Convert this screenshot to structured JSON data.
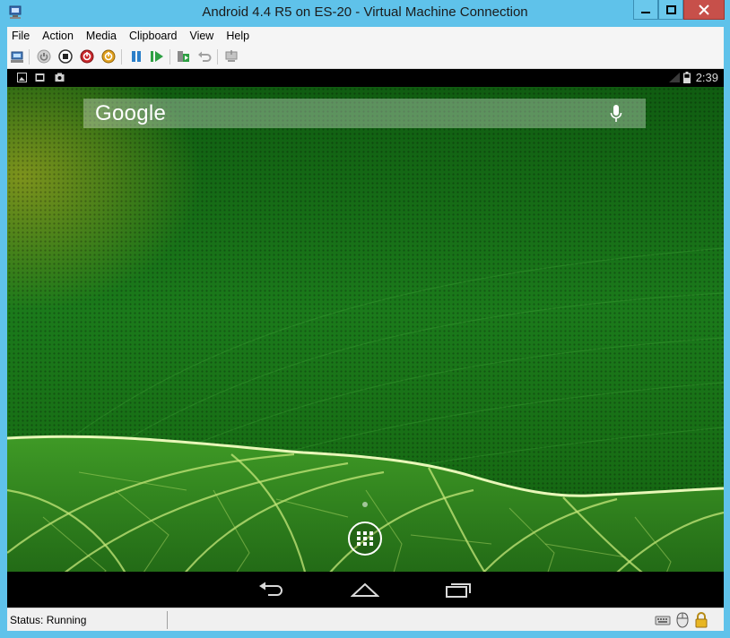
{
  "window": {
    "title": "Android 4.4 R5 on ES-20 - Virtual Machine Connection"
  },
  "menu": {
    "items": [
      "File",
      "Action",
      "Media",
      "Clipboard",
      "View",
      "Help"
    ]
  },
  "toolbar": {
    "buttons": [
      "ctrl-alt-del-icon",
      "start-icon",
      "turn-off-icon",
      "shut-down-icon",
      "save-icon",
      "pause-icon",
      "resume-icon",
      "checkpoint-icon",
      "revert-icon",
      "enhanced-session-icon"
    ]
  },
  "android": {
    "clock": "2:39",
    "search_logo": "Google",
    "wallpaper_colors": {
      "top": "#125e0f",
      "mid": "#1a7a1a",
      "leaf": "#2f8a1e",
      "vein": "#c6e77a"
    }
  },
  "status": {
    "text": "Status: Running"
  },
  "colors": {
    "chrome": "#5fc2ea",
    "close_button": "#c7504a",
    "menu_bg": "#f5f5f5"
  }
}
